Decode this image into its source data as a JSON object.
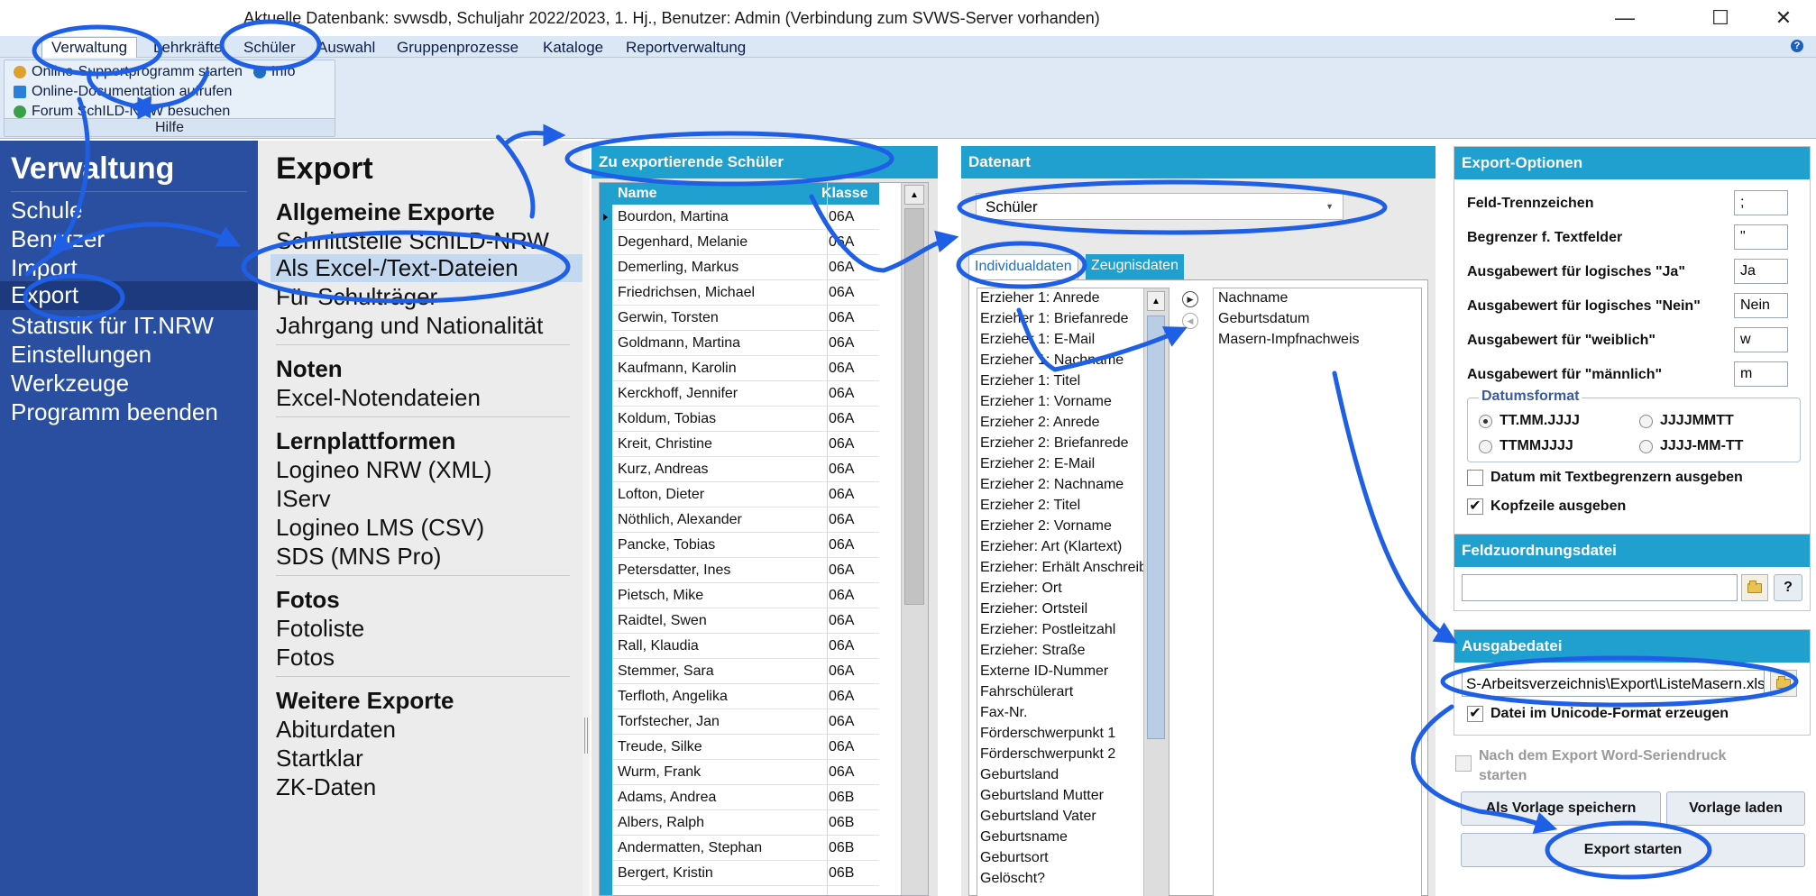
{
  "window": {
    "title": "Aktuelle Datenbank: svwsdb, Schuljahr 2022/2023, 1. Hj., Benutzer: Admin (Verbindung zum SVWS-Server vorhanden)",
    "minimize": "—",
    "maximize": "☐",
    "close": "✕"
  },
  "menu": {
    "items": [
      "Verwaltung",
      "Lehrkräfte",
      "Schüler",
      "Auswahl",
      "Gruppenprozesse",
      "Kataloge",
      "Reportverwaltung"
    ],
    "help": "?"
  },
  "ribbon": {
    "links": [
      "Online-Supportprogramm starten",
      "Info",
      "Online-Documentation aufrufen",
      "Forum SchILD-NRW besuchen"
    ],
    "group_caption": "Hilfe"
  },
  "nav": {
    "title": "Verwaltung",
    "items": [
      "Schule",
      "Benutzer",
      "Import",
      "Export",
      "Statistik für IT.NRW",
      "Einstellungen",
      "Werkzeuge",
      "Programm beenden"
    ],
    "selected": "Export"
  },
  "categories": {
    "title": "Export",
    "sections": [
      {
        "heading": "Allgemeine Exporte",
        "items": [
          "Schnittstelle SchILD-NRW",
          "Als Excel-/Text-Dateien",
          "Für Schulträger",
          "Jahrgang und Nationalität"
        ]
      },
      {
        "heading": "Noten",
        "items": [
          "Excel-Notendateien"
        ]
      },
      {
        "heading": "Lernplattformen",
        "items": [
          "Logineo NRW (XML)",
          "IServ",
          "Logineo LMS (CSV)",
          "SDS (MNS Pro)"
        ]
      },
      {
        "heading": "Fotos",
        "items": [
          "Fotoliste",
          "Fotos"
        ]
      },
      {
        "heading": "Weitere Exporte",
        "items": [
          "Abiturdaten",
          "Startklar",
          "ZK-Daten"
        ]
      }
    ],
    "selected": "Als Excel-/Text-Dateien"
  },
  "students": {
    "header": "Zu exportierende Schüler",
    "col_name": "Name",
    "col_class": "Klasse",
    "rows": [
      [
        "Bourdon, Martina",
        "06A"
      ],
      [
        "Degenhard, Melanie",
        "06A"
      ],
      [
        "Demerling, Markus",
        "06A"
      ],
      [
        "Friedrichsen, Michael",
        "06A"
      ],
      [
        "Gerwin, Torsten",
        "06A"
      ],
      [
        "Goldmann, Martina",
        "06A"
      ],
      [
        "Kaufmann, Karolin",
        "06A"
      ],
      [
        "Kerckhoff, Jennifer",
        "06A"
      ],
      [
        "Koldum, Tobias",
        "06A"
      ],
      [
        "Kreit, Christine",
        "06A"
      ],
      [
        "Kurz, Andreas",
        "06A"
      ],
      [
        "Lofton, Dieter",
        "06A"
      ],
      [
        "Nöthlich, Alexander",
        "06A"
      ],
      [
        "Pancke, Tobias",
        "06A"
      ],
      [
        "Petersdatter, Ines",
        "06A"
      ],
      [
        "Pietsch, Mike",
        "06A"
      ],
      [
        "Raidtel, Swen",
        "06A"
      ],
      [
        "Rall, Klaudia",
        "06A"
      ],
      [
        "Stemmer, Sara",
        "06A"
      ],
      [
        "Terfloth, Angelika",
        "06A"
      ],
      [
        "Torfstecher, Jan",
        "06A"
      ],
      [
        "Treude, Silke",
        "06A"
      ],
      [
        "Wurm, Frank",
        "06A"
      ],
      [
        "Adams, Andrea",
        "06B"
      ],
      [
        "Albers, Ralph",
        "06B"
      ],
      [
        "Andermatten, Stephan",
        "06B"
      ],
      [
        "Bergert, Kristin",
        "06B"
      ]
    ]
  },
  "datenart": {
    "header": "Datenart",
    "selected": "Schüler",
    "tabs": [
      "Individualdaten",
      "Zeugnisdaten"
    ],
    "available_fields": [
      "Erzieher 1: Anrede",
      "Erzieher 1: Briefanrede",
      "Erzieher 1: E-Mail",
      "Erzieher 1: Nachname",
      "Erzieher 1: Titel",
      "Erzieher 1: Vorname",
      "Erzieher 2: Anrede",
      "Erzieher 2: Briefanrede",
      "Erzieher 2: E-Mail",
      "Erzieher 2: Nachname",
      "Erzieher 2: Titel",
      "Erzieher 2: Vorname",
      "Erzieher: Art (Klartext)",
      "Erzieher: Erhält Anschreiben",
      "Erzieher: Ort",
      "Erzieher: Ortsteil",
      "Erzieher: Postleitzahl",
      "Erzieher: Straße",
      "Externe ID-Nummer",
      "Fahrschülerart",
      "Fax-Nr.",
      "Förderschwerpunkt 1",
      "Förderschwerpunkt 2",
      "Geburtsland",
      "Geburtsland Mutter",
      "Geburtsland Vater",
      "Geburtsname",
      "Geburtsort",
      "Gelöscht?"
    ],
    "selected_fields": [
      "Nachname",
      "Geburtsdatum",
      "Masern-Impfnachweis"
    ]
  },
  "options": {
    "header": "Export-Optionen",
    "fields": [
      {
        "label": "Feld-Trennzeichen",
        "value": ";"
      },
      {
        "label": "Begrenzer f. Textfelder",
        "value": "\""
      },
      {
        "label": "Ausgabewert für logisches \"Ja\"",
        "value": "Ja"
      },
      {
        "label": "Ausgabewert für logisches \"Nein\"",
        "value": "Nein"
      },
      {
        "label": "Ausgabewert für \"weiblich\"",
        "value": "w"
      },
      {
        "label": "Ausgabewert für \"männlich\"",
        "value": "m"
      }
    ],
    "date_legend": "Datumsformat",
    "date_formats": [
      "TT.MM.JJJJ",
      "JJJJMMTT",
      "TTMMJJJJ",
      "JJJJ-MM-TT"
    ],
    "date_selected": "TT.MM.JJJJ",
    "check_textdelim": "Datum mit Textbegrenzern ausgeben",
    "check_header": "Kopfzeile ausgeben"
  },
  "feldzuordnung": {
    "header": "Feldzuordnungsdatei",
    "value": "",
    "help_button": "?"
  },
  "ausgabe": {
    "header": "Ausgabedatei",
    "value": "S-Arbeitsverzeichnis\\Export\\ListeMasern.xlsx",
    "check_unicode": "Datei im Unicode-Format erzeugen",
    "check_word": "Nach dem Export Word-Seriendruck starten",
    "btn_save_template": "Als Vorlage speichern",
    "btn_load_template": "Vorlage laden",
    "btn_export": "Export starten"
  },
  "colors": {
    "accent": "#1fa0cf",
    "nav": "#2b4fa0",
    "annotation": "#1e5fe6"
  }
}
